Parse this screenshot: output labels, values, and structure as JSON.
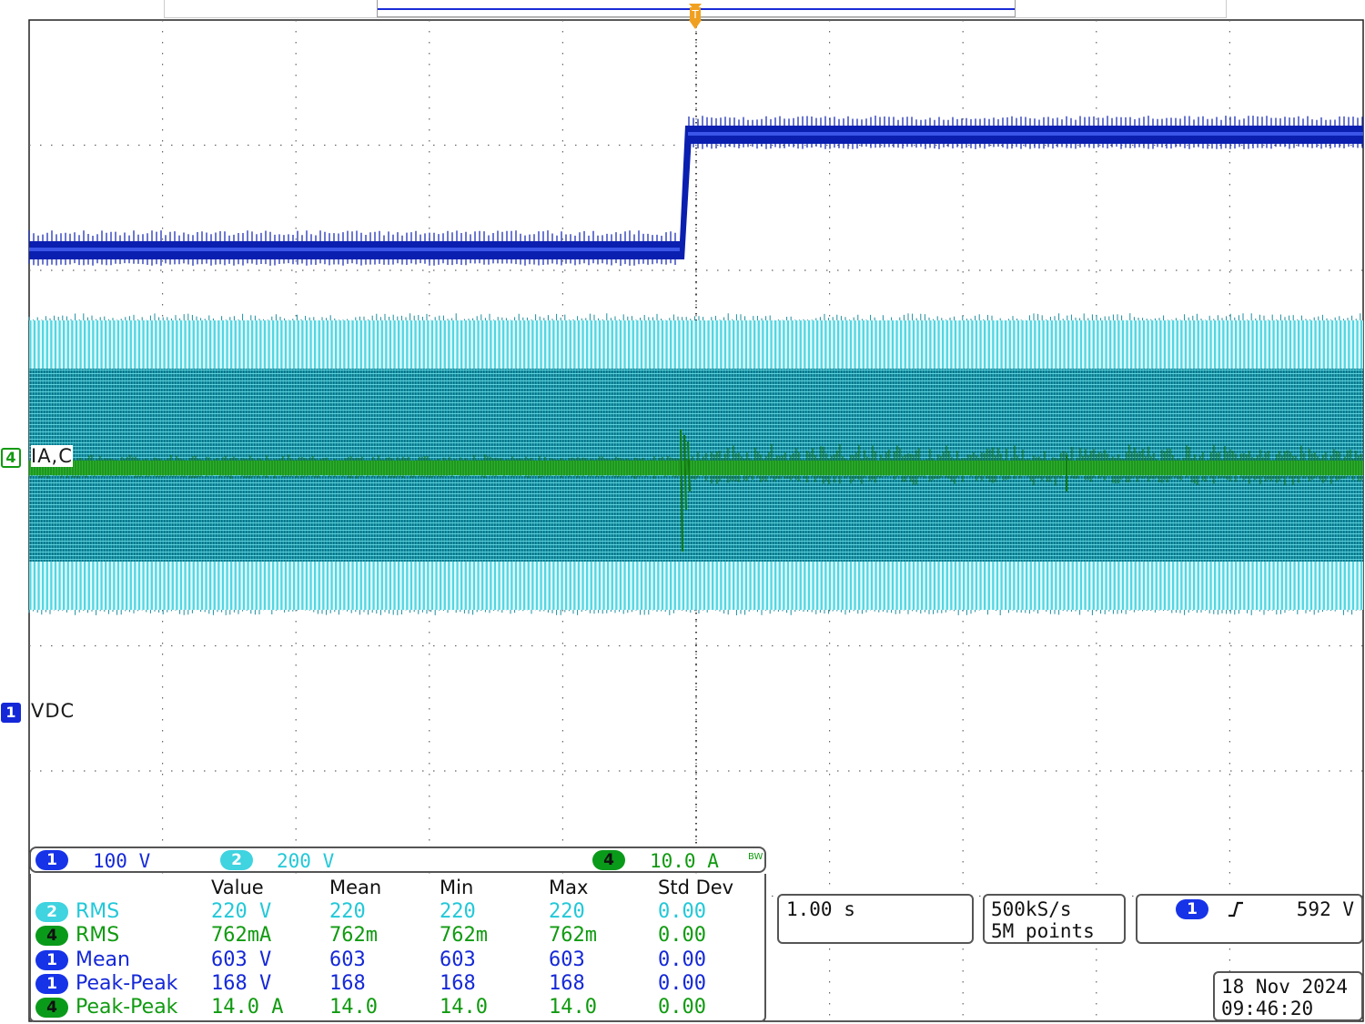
{
  "channels": {
    "ch1": {
      "number": "1",
      "label": "VDC",
      "scale": "100 V",
      "color": "#0a20c8"
    },
    "ch2": {
      "number": "2",
      "scale": "200 V",
      "color": "#40d3e0"
    },
    "ch4": {
      "number": "4",
      "label": "IA,C",
      "scale": "10.0 A",
      "color": "#20a020"
    }
  },
  "bandwidth_limit_icon": "BW",
  "trigger_marker": "T",
  "measurements": {
    "columns": [
      "Value",
      "Mean",
      "Min",
      "Max",
      "Std Dev"
    ],
    "rows": [
      {
        "channel": "2",
        "type": "RMS",
        "value": "220 V",
        "mean": "220",
        "min": "220",
        "max": "220",
        "std": "0.00",
        "color": "#22c8d8"
      },
      {
        "channel": "4",
        "type": "RMS",
        "value": "762mA",
        "mean": "762m",
        "min": "762m",
        "max": "762m",
        "std": "0.00",
        "color": "#109a10"
      },
      {
        "channel": "1",
        "type": "Mean",
        "value": "603 V",
        "mean": "603",
        "min": "603",
        "max": "603",
        "std": "0.00",
        "color": "#1428d8"
      },
      {
        "channel": "1",
        "type": "Peak-Peak",
        "value": "168 V",
        "mean": "168",
        "min": "168",
        "max": "168",
        "std": "0.00",
        "color": "#1428d8"
      },
      {
        "channel": "4",
        "type": "Peak-Peak",
        "value": "14.0 A",
        "mean": "14.0",
        "min": "14.0",
        "max": "14.0",
        "std": "0.00",
        "color": "#109a10"
      }
    ]
  },
  "timebase": "1.00 s",
  "acquisition": {
    "sample_rate": "500kS/s",
    "record_length": "5M points"
  },
  "trigger": {
    "source": "1",
    "slope_icon": "rising-edge-icon",
    "level": "592 V"
  },
  "datetime": {
    "date": "18 Nov 2024",
    "time": "09:46:20"
  }
}
